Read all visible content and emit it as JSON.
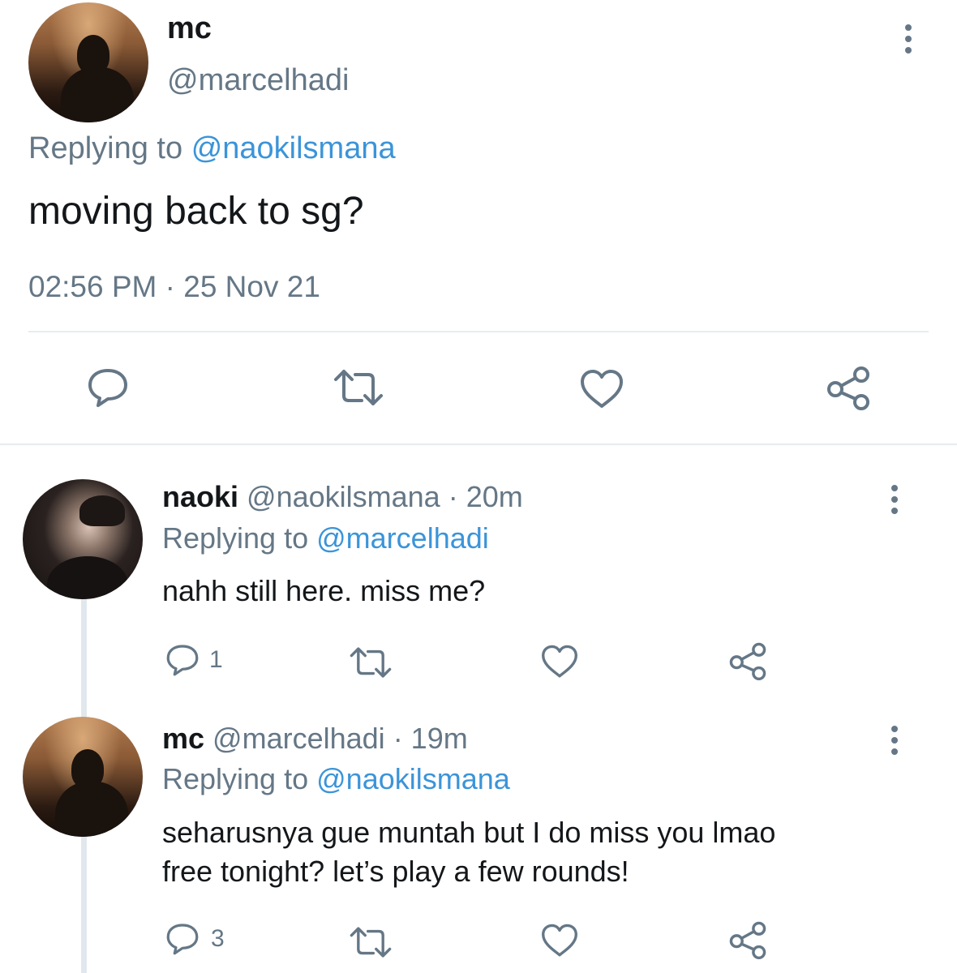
{
  "main_tweet": {
    "display_name": "mc",
    "handle": "@marcelhadi",
    "replying_label": "Replying to",
    "replying_to": "@naokilsmana",
    "text": "moving back to sg?",
    "timestamp": "02:56 PM · 25 Nov 21"
  },
  "replies": [
    {
      "display_name": "naoki",
      "handle": "@naokilsmana",
      "time": "· 20m",
      "replying_label": "Replying to",
      "replying_to": "@marcelhadi",
      "text_lines": [
        "nahh still here. miss me?"
      ],
      "reply_count": "1"
    },
    {
      "display_name": "mc",
      "handle": "@marcelhadi",
      "time": "· 19m",
      "replying_label": "Replying to",
      "replying_to": "@naokilsmana",
      "text_lines": [
        "seharusnya gue muntah but I do miss you lmao",
        "free tonight? let’s play a few rounds!"
      ],
      "reply_count": "3"
    }
  ],
  "icons": [
    "reply-icon",
    "retweet-icon",
    "like-icon",
    "share-icon",
    "more-icon"
  ],
  "colors": {
    "link": "#3b94d9",
    "secondary": "#657786",
    "divider": "#e6ecf0",
    "text": "#14171a"
  }
}
